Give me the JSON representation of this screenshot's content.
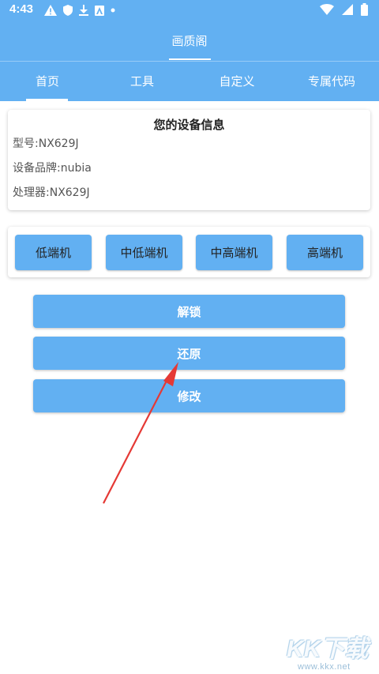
{
  "status_bar": {
    "time": "4:43",
    "icons_left": [
      "warning-icon",
      "shield-icon",
      "download-icon",
      "a-icon",
      "dot-icon"
    ],
    "icons_right": [
      "wifi-icon",
      "signal-icon",
      "battery-icon"
    ]
  },
  "app": {
    "title": "画质阁",
    "accent_color": "#62b0f2"
  },
  "tabs": [
    {
      "label": "首页",
      "active": true
    },
    {
      "label": "工具",
      "active": false
    },
    {
      "label": "自定义",
      "active": false
    },
    {
      "label": "专属代码",
      "active": false
    }
  ],
  "device_info": {
    "title": "您的设备信息",
    "model": "型号:NX629J",
    "brand": "设备品牌:nubia",
    "processor": "处理器:NX629J"
  },
  "levels": [
    "低端机",
    "中低端机",
    "中高端机",
    "高端机"
  ],
  "actions": {
    "unlock": "解锁",
    "restore": "还原",
    "modify": "修改"
  },
  "watermark": {
    "logo_text": "KK下载",
    "url": "www.kkx.net"
  }
}
